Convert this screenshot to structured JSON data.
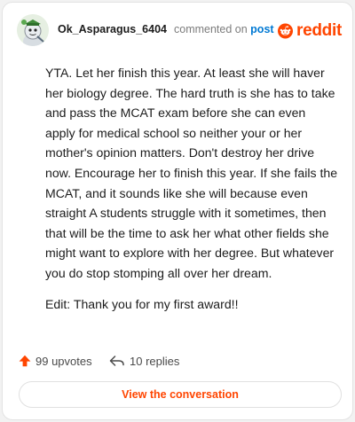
{
  "header": {
    "username": "Ok_Asparagus_6404",
    "commented_on": "commented on",
    "post_link": "post",
    "brand": "reddit"
  },
  "comment": {
    "paragraphs": [
      "YTA. Let her finish this year. At least she will haver her biology degree. The hard truth is she has to take and pass the MCAT exam before she can even apply for medical school so neither your or her mother's opinion matters. Don't destroy her drive now. Encourage her to finish this year. If she fails the MCAT, and it sounds like she will because even straight A students struggle with it sometimes, then that will be the time to ask her what other fields she might want to explore with her degree. But whatever you do stop stomping all over her dream.",
      "Edit: Thank you for my first award!!"
    ]
  },
  "stats": {
    "upvotes": "99 upvotes",
    "replies": "10 replies"
  },
  "cta": {
    "label": "View the conversation"
  },
  "colors": {
    "brand": "#ff4500",
    "link": "#0079d3",
    "text": "#1c1c1c",
    "muted": "#7c7c7c"
  },
  "icons": {
    "upvote": "upvote-arrow-icon",
    "reply": "reply-arrow-icon",
    "brand": "reddit-snoo-icon"
  }
}
